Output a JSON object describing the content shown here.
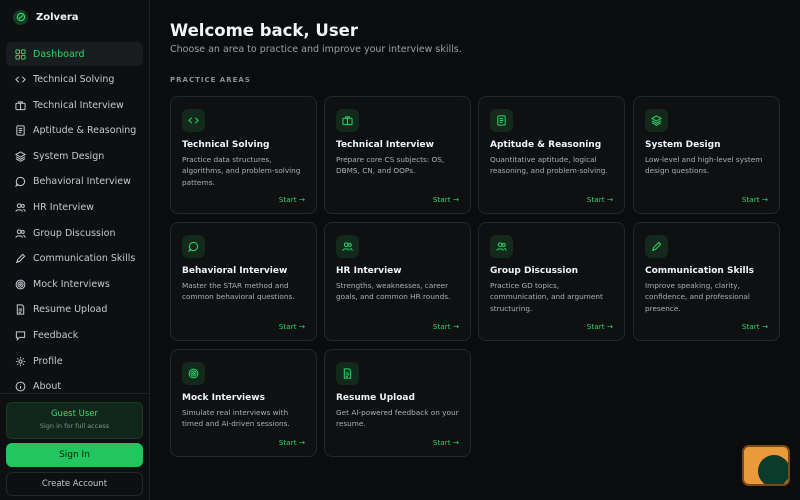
{
  "brand": {
    "name": "Zolvera"
  },
  "nav": [
    {
      "label": "Dashboard",
      "icon": "grid-icon",
      "active": true
    },
    {
      "label": "Technical Solving",
      "icon": "code-icon"
    },
    {
      "label": "Technical Interview",
      "icon": "briefcase-icon"
    },
    {
      "label": "Aptitude & Reasoning",
      "icon": "notebook-icon"
    },
    {
      "label": "System Design",
      "icon": "layers-icon"
    },
    {
      "label": "Behavioral Interview",
      "icon": "chat-icon"
    },
    {
      "label": "HR Interview",
      "icon": "users-icon"
    },
    {
      "label": "Group Discussion",
      "icon": "users-icon"
    },
    {
      "label": "Communication Skills",
      "icon": "pen-icon"
    },
    {
      "label": "Mock Interviews",
      "icon": "target-icon"
    },
    {
      "label": "Resume Upload",
      "icon": "file-icon"
    },
    {
      "label": "Feedback",
      "icon": "message-icon"
    },
    {
      "label": "Profile",
      "icon": "gear-icon"
    },
    {
      "label": "About",
      "icon": "info-icon"
    }
  ],
  "sidebar_footer": {
    "guest_title": "Guest User",
    "guest_sub": "Sign in for full access",
    "signin_label": "Sign In",
    "create_label": "Create Account"
  },
  "header": {
    "title": "Welcome back, User",
    "subtitle": "Choose an area to practice and improve your interview skills."
  },
  "section_title": "PRACTICE AREAS",
  "cards": [
    {
      "title": "Technical Solving",
      "desc": "Practice data structures, algorithms, and problem-solving patterns.",
      "start": "Start →",
      "icon": "code-icon"
    },
    {
      "title": "Technical Interview",
      "desc": "Prepare core CS subjects: OS, DBMS, CN, and OOPs.",
      "start": "Start →",
      "icon": "briefcase-icon"
    },
    {
      "title": "Aptitude & Reasoning",
      "desc": "Quantitative aptitude, logical reasoning, and problem-solving.",
      "start": "Start →",
      "icon": "notebook-icon"
    },
    {
      "title": "System Design",
      "desc": "Low-level and high-level system design questions.",
      "start": "Start →",
      "icon": "layers-icon"
    },
    {
      "title": "Behavioral Interview",
      "desc": "Master the STAR method and common behavioral questions.",
      "start": "Start →",
      "icon": "chat-icon"
    },
    {
      "title": "HR Interview",
      "desc": "Strengths, weaknesses, career goals, and common HR rounds.",
      "start": "Start →",
      "icon": "users-icon"
    },
    {
      "title": "Group Discussion",
      "desc": "Practice GD topics, communication, and argument structuring.",
      "start": "Start →",
      "icon": "users-icon"
    },
    {
      "title": "Communication Skills",
      "desc": "Improve speaking, clarity, confidence, and professional presence.",
      "start": "Start →",
      "icon": "pen-icon"
    },
    {
      "title": "Mock Interviews",
      "desc": "Simulate real interviews with timed and AI-driven sessions.",
      "start": "Start →",
      "icon": "target-icon"
    },
    {
      "title": "Resume Upload",
      "desc": "Get AI-powered feedback on your resume.",
      "start": "Start →",
      "icon": "file-icon"
    }
  ],
  "colors": {
    "accent": "#22c55e",
    "background": "#0b0c0e"
  }
}
